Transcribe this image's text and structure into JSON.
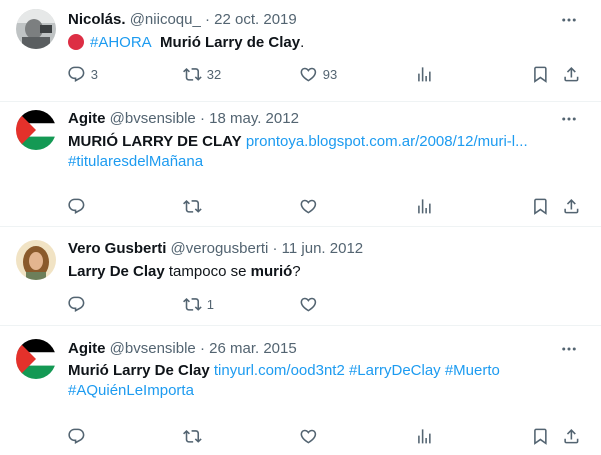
{
  "tweets": [
    {
      "name": "Nicolás.",
      "handle": "@niicoqu_",
      "date": "22 oct. 2019",
      "body": {
        "hashtag": "#AHORA",
        "text_bold": "Murió Larry de Clay",
        "text_end": "."
      },
      "counts": {
        "reply": "3",
        "retweet": "32",
        "like": "93"
      }
    },
    {
      "name": "Agite",
      "handle": "@bvsensible",
      "date": "18 may. 2012",
      "body": {
        "text_bold": "MURIÓ LARRY DE CLAY",
        "link": "prontoya.blogspot.com.ar/2008/12/muri-l...",
        "hashtag": "#titularesdelMañana"
      },
      "counts": {
        "reply": "",
        "retweet": "",
        "like": ""
      }
    },
    {
      "name": "Vero Gusberti",
      "handle": "@verogusberti",
      "date": "11 jun. 2012",
      "body": {
        "text_bold1": "Larry De Clay",
        "text_mid": " tampoco se ",
        "text_bold2": "murió",
        "text_end": "?"
      },
      "counts": {
        "reply": "",
        "retweet": "1",
        "like": ""
      }
    },
    {
      "name": "Agite",
      "handle": "@bvsensible",
      "date": "26 mar. 2015",
      "body": {
        "text_bold": "Murió Larry De Clay",
        "link": "tinyurl.com/ood3nt2",
        "hashtag1": "#LarryDeClay",
        "hashtag2": "#Muerto",
        "hashtag3": "#AQuiénLeImporta"
      },
      "counts": {
        "reply": "",
        "retweet": "",
        "like": ""
      }
    }
  ],
  "separator": "·",
  "icons": {
    "reply": "reply-icon",
    "retweet": "retweet-icon",
    "like": "heart-icon",
    "views": "views-icon",
    "bookmark": "bookmark-icon",
    "share": "share-icon",
    "more": "more-icon"
  },
  "colors": {
    "link": "#1d9bf0",
    "meta": "#536471",
    "text": "#0f1419",
    "dot": "#dd2e44"
  }
}
